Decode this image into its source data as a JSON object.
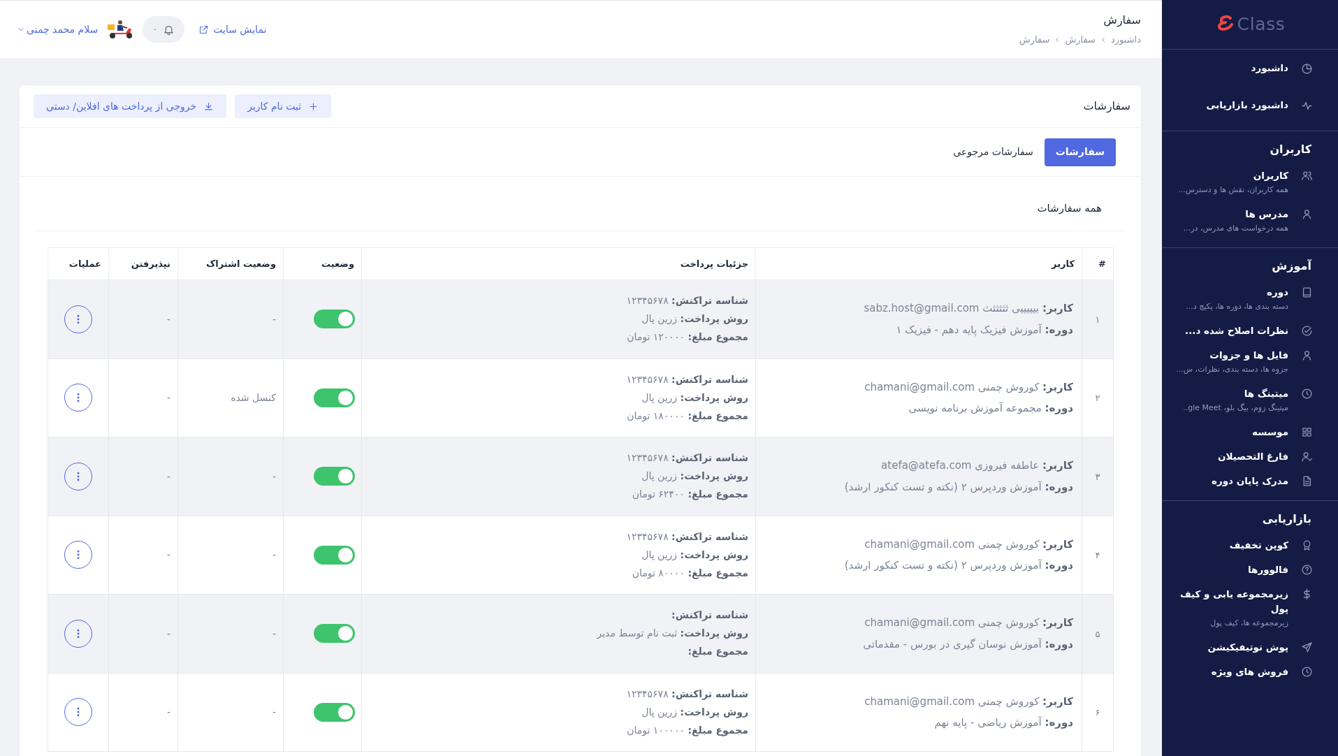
{
  "sidebar": {
    "logo": "Class",
    "sections": [
      {
        "items": [
          {
            "label": "داشبورد"
          },
          {
            "label": "داشبورد بازاریابی"
          }
        ]
      },
      {
        "heading": "کاربران",
        "items": [
          {
            "label": "کاربران",
            "description": "همه کاربران، نقش ها و دسترس..."
          },
          {
            "label": "مدرس ها",
            "description": "همه درخواست های مدرس، در..."
          }
        ]
      },
      {
        "heading": "آموزش",
        "items": [
          {
            "label": "دوره",
            "description": "دسته بندی ها، دوره ها، پکیج د..."
          },
          {
            "label": "نظرات اصلاح شده د..."
          },
          {
            "label": "فایل ها و جزوات",
            "description": "جزوه ها، دسته بندی، نظرات، س..."
          },
          {
            "label": "میتینگ ها",
            "description": "میتینگ زوم، بیگ بلو، gle Meet.."
          },
          {
            "label": "موسسه"
          },
          {
            "label": "فارغ التحصیلان"
          },
          {
            "label": "مدرک پایان دوره"
          }
        ]
      },
      {
        "heading": "بازاریابی",
        "items": [
          {
            "label": "کوپن تخفیف"
          },
          {
            "label": "فالوورها"
          },
          {
            "label": "زیرمجموعه یابی و کیف پول",
            "description": "زیرمجموعه ها، کیف پول"
          },
          {
            "label": "پوش نوتیفیکیشن"
          },
          {
            "label": "فروش های ویژه"
          }
        ]
      }
    ]
  },
  "header": {
    "title": "سفارش",
    "breadcrumb": [
      "داشبورد",
      "سفارش",
      "سفارش"
    ],
    "site_link": "نمایش سایت",
    "notifications": "۰",
    "greeting": "سلام محمد چمنی"
  },
  "card": {
    "title": "سفارشات",
    "actions": [
      {
        "kind": "add",
        "label": "ثبت نام کاربر"
      },
      {
        "kind": "export",
        "label": "خروجی از پرداخت های افلاین/ دستی"
      }
    ],
    "tabs": [
      {
        "label": "سفارشات",
        "selected": true
      },
      {
        "label": "سفارشات مرجوعی",
        "selected": false
      }
    ],
    "subtitle": "همه سفارشات",
    "table": {
      "columns": [
        "#",
        "کاربر",
        "جزئیات پرداخت",
        "وضعیت",
        "وضعیت اشتراک",
        "نپذیرفتن",
        "عملیات"
      ],
      "rows": [
        {
          "number": "۱",
          "user": [
            {
              "label": "کاربر:",
              "value": "بیییییی ثثثثثث sabz.host@gmail.com"
            },
            {
              "label": "دوره:",
              "value": "آموزش فیزیک پایه دهم - فیزیک ۱"
            }
          ],
          "payment": [
            {
              "label": "شناسه تراکنش:",
              "value": "۱۲۳۴۵۶۷۸"
            },
            {
              "label": "روش پرداخت:",
              "value": "زرین پال"
            },
            {
              "label": "مجموع مبلغ:",
              "value": "۱۲۰۰۰۰ تومان"
            }
          ],
          "status_on": true,
          "subscription": "-",
          "reject": "-"
        },
        {
          "number": "۲",
          "user": [
            {
              "label": "کاربر:",
              "value": "کوروش چمنی chamani@gmail.com"
            },
            {
              "label": "دوره:",
              "value": "مجموعه آموزش برنامه نویسی"
            }
          ],
          "payment": [
            {
              "label": "شناسه تراکنش:",
              "value": "۱۲۳۴۵۶۷۸"
            },
            {
              "label": "روش پرداخت:",
              "value": "زرین پال"
            },
            {
              "label": "مجموع مبلغ:",
              "value": "۱۸۰۰۰۰ تومان"
            }
          ],
          "status_on": true,
          "subscription": "کنسل شده",
          "reject": "-"
        },
        {
          "number": "۳",
          "user": [
            {
              "label": "کاربر:",
              "value": "عاطفه فیروزی atefa@atefa.com"
            },
            {
              "label": "دوره:",
              "value": "آموزش وردپرس ۲ (نکته و تست کنکور ارشد)"
            }
          ],
          "payment": [
            {
              "label": "شناسه تراکنش:",
              "value": "۱۲۳۴۵۶۷۸"
            },
            {
              "label": "روش پرداخت:",
              "value": "زرین پال"
            },
            {
              "label": "مجموع مبلغ:",
              "value": "۶۲۴۰۰ تومان"
            }
          ],
          "status_on": true,
          "subscription": "-",
          "reject": "-"
        },
        {
          "number": "۴",
          "user": [
            {
              "label": "کاربر:",
              "value": "کوروش چمنی chamani@gmail.com"
            },
            {
              "label": "دوره:",
              "value": "آموزش وردپرس ۲ (نکته و تست کنکور ارشد)"
            }
          ],
          "payment": [
            {
              "label": "شناسه تراکنش:",
              "value": "۱۲۳۴۵۶۷۸"
            },
            {
              "label": "روش پرداخت:",
              "value": "زرین پال"
            },
            {
              "label": "مجموع مبلغ:",
              "value": "۸۰۰۰۰ تومان"
            }
          ],
          "status_on": true,
          "subscription": "-",
          "reject": "-"
        },
        {
          "number": "۵",
          "user": [
            {
              "label": "کاربر:",
              "value": "کوروش چمنی chamani@gmail.com"
            },
            {
              "label": "دوره:",
              "value": "آموزش نوسان گیری در بورس - مقدماتی"
            }
          ],
          "payment": [
            {
              "label": "شناسه تراکنش:"
            },
            {
              "label": "روش پرداخت:",
              "value": "ثبت نام توسط مدیر"
            },
            {
              "label": "مجموع مبلغ:"
            }
          ],
          "status_on": true,
          "subscription": "-",
          "reject": "-"
        },
        {
          "number": "۶",
          "user": [
            {
              "label": "کاربر:",
              "value": "کوروش چمنی chamani@gmail.com"
            },
            {
              "label": "دوره:",
              "value": "آموزش ریاضی - پایه نهم"
            }
          ],
          "payment": [
            {
              "label": "شناسه تراکنش:",
              "value": "۱۲۳۴۵۶۷۸"
            },
            {
              "label": "روش پرداخت:",
              "value": "زرین پال"
            },
            {
              "label": "مجموع مبلغ:",
              "value": "۱۰۰۰۰۰ تومان"
            }
          ],
          "status_on": true,
          "subscription": "-",
          "reject": "-"
        }
      ]
    }
  }
}
